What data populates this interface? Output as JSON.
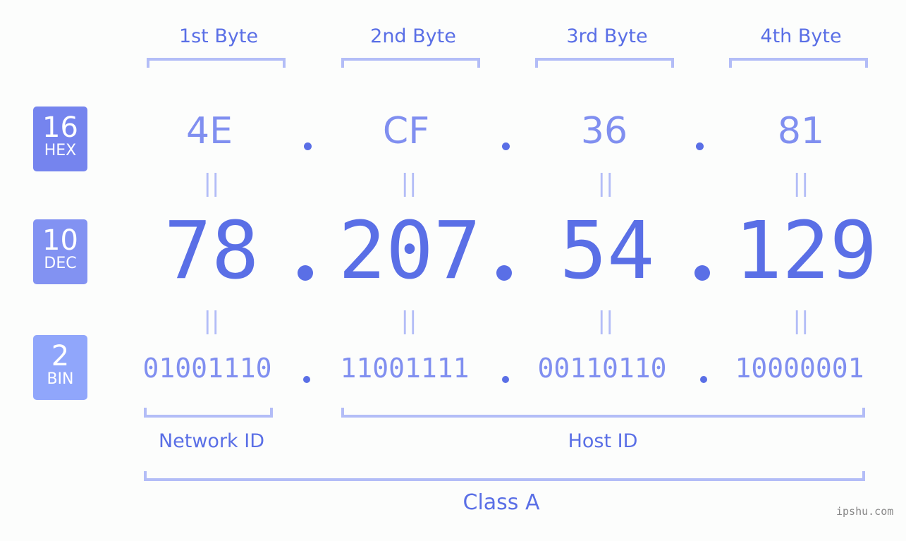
{
  "bytes": [
    {
      "title": "1st Byte",
      "hex": "4E",
      "dec": "78",
      "bin": "01001110"
    },
    {
      "title": "2nd Byte",
      "hex": "CF",
      "dec": "207",
      "bin": "11001111"
    },
    {
      "title": "3rd Byte",
      "hex": "36",
      "dec": "54",
      "bin": "00110110"
    },
    {
      "title": "4th Byte",
      "hex": "81",
      "dec": "129",
      "bin": "10000001"
    }
  ],
  "badges": {
    "hex": {
      "base": "16",
      "label": "HEX",
      "color": "#7584ee"
    },
    "dec": {
      "base": "10",
      "label": "DEC",
      "color": "#8292f2"
    },
    "bin": {
      "base": "2",
      "label": "BIN",
      "color": "#90a6fb"
    }
  },
  "equals_symbol": "||",
  "segments": {
    "network": "Network ID",
    "host": "Host ID",
    "class": "Class A"
  },
  "watermark": "ipshu.com",
  "colors": {
    "primary": "#5a6fe6",
    "secondary": "#808ff0",
    "bracket": "#b3bdf7",
    "background": "#fcfdfc"
  }
}
